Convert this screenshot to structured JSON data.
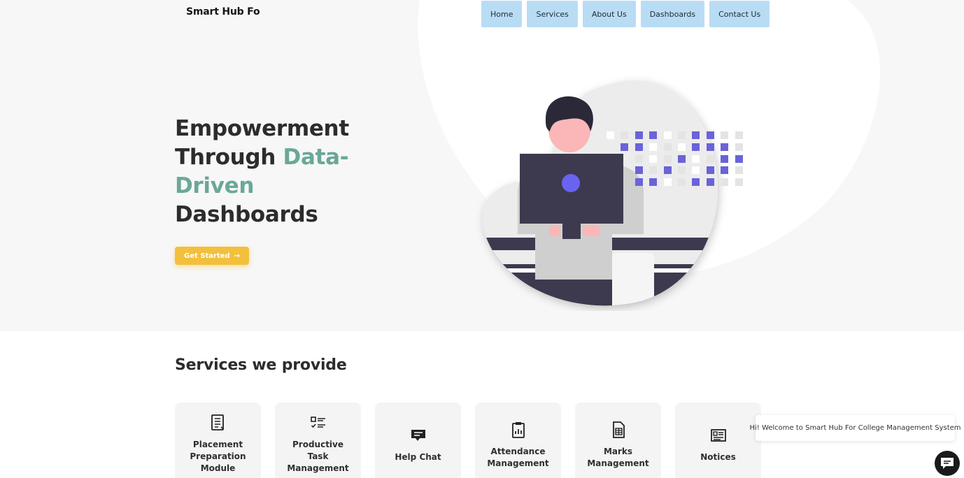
{
  "header": {
    "brand": "Smart Hub For College Management System"
  },
  "nav": {
    "items": [
      "Home",
      "Services",
      "About Us",
      "Dashboards",
      "Contact Us"
    ]
  },
  "hero": {
    "line1": "Empowerment",
    "line2_plain": "Through ",
    "line2_accent": "Data-",
    "line3_accent": "Driven",
    "line4": "Dashboards",
    "cta_label": "Get Started",
    "cta_arrow": "→",
    "accent_color": "#6aa898",
    "cta_color": "#f2c03c"
  },
  "services": {
    "title": "Services we provide",
    "cards": [
      {
        "label": "Placement Preparation Module",
        "icon": "document-list-icon"
      },
      {
        "label": "Productive Task Management",
        "icon": "checklist-icon"
      },
      {
        "label": "Help Chat",
        "icon": "chat-message-icon"
      },
      {
        "label": "Attendance Management",
        "icon": "clipboard-chart-icon"
      },
      {
        "label": "Marks Management",
        "icon": "spreadsheet-file-icon"
      },
      {
        "label": "Notices",
        "icon": "notice-board-icon"
      }
    ]
  },
  "chat": {
    "welcome": "Hi! Welcome to Smart Hub For College Management System",
    "icon": "chat-bubble-icon"
  }
}
